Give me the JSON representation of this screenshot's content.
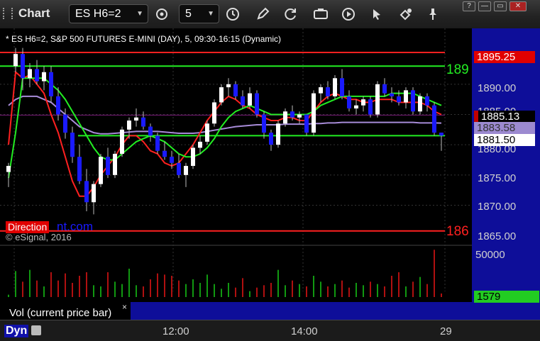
{
  "window": {
    "title": "Chart",
    "minimize": "—",
    "restore": "▭",
    "close": "✕",
    "help": "?"
  },
  "toolbar": {
    "symbol": "ES H6=2",
    "interval": "5"
  },
  "chart": {
    "header": "* ES H6=2, S&P 500 FUTURES E-MINI (DAY), 5, 09:30-16:15 (Dynamic)",
    "copyright": "© eSignal, 2016",
    "watermark_left": "Direction",
    "watermark_right": "nt.com",
    "right_green_label": "189",
    "right_red_label": "186",
    "price_flags": {
      "top_red": "1895.25",
      "red_mid": "1885.13",
      "purple": "1883.58",
      "white": "1881.50"
    },
    "price_ticks": [
      "1890.00",
      "1885.00",
      "1880.00",
      "1875.00",
      "1870.00",
      "1865.00"
    ],
    "volume_ticks": [
      "50000"
    ],
    "volume_flag": "1579",
    "volume_label": "Vol (current price bar)",
    "volume_close": "×",
    "time_ticks": [
      "12:00",
      "14:00",
      "29"
    ],
    "bottom_label": "Dyn",
    "colors": {
      "up_candle": "#ffffff",
      "down_candle": "#1a1aff",
      "red_line": "#ff2020",
      "green_line": "#22ee22",
      "purple_line": "#a78bd8",
      "volume_red": "#b01010",
      "volume_green": "#119911"
    }
  },
  "chart_data": {
    "type": "candlestick",
    "horizontal_lines": [
      {
        "price": 1895.25,
        "color": "#ff2020"
      },
      {
        "price": 1893.0,
        "color": "#22ee22"
      },
      {
        "price": 1881.5,
        "color": "#22ee22"
      },
      {
        "price": 1865.75,
        "color": "#ff2020"
      }
    ],
    "ohlc": [
      [
        1875.5,
        1877.0,
        1873.0,
        1876.5
      ],
      [
        1893.0,
        1896.0,
        1892.0,
        1895.0
      ],
      [
        1895.0,
        1896.0,
        1889.0,
        1891.0
      ],
      [
        1891.0,
        1893.5,
        1889.5,
        1892.5
      ],
      [
        1892.5,
        1894.0,
        1890.0,
        1890.5
      ],
      [
        1890.5,
        1893.0,
        1889.0,
        1892.0
      ],
      [
        1892.0,
        1893.0,
        1887.0,
        1888.0
      ],
      [
        1888.0,
        1889.5,
        1884.0,
        1885.0
      ],
      [
        1885.0,
        1886.0,
        1881.0,
        1882.0
      ],
      [
        1882.0,
        1883.0,
        1877.0,
        1878.0
      ],
      [
        1878.0,
        1880.0,
        1873.5,
        1874.0
      ],
      [
        1874.0,
        1876.0,
        1869.0,
        1870.5
      ],
      [
        1870.5,
        1874.0,
        1868.5,
        1873.5
      ],
      [
        1873.5,
        1878.5,
        1873.0,
        1878.0
      ],
      [
        1878.0,
        1879.5,
        1874.5,
        1875.0
      ],
      [
        1875.0,
        1879.0,
        1874.5,
        1878.5
      ],
      [
        1878.5,
        1883.0,
        1878.0,
        1882.5
      ],
      [
        1882.5,
        1884.5,
        1881.0,
        1884.0
      ],
      [
        1884.0,
        1886.0,
        1883.0,
        1884.5
      ],
      [
        1884.5,
        1885.5,
        1882.5,
        1883.0
      ],
      [
        1883.0,
        1883.5,
        1880.5,
        1881.5
      ],
      [
        1881.5,
        1882.0,
        1878.5,
        1879.0
      ],
      [
        1879.0,
        1880.5,
        1877.5,
        1878.0
      ],
      [
        1878.0,
        1879.0,
        1876.0,
        1877.0
      ],
      [
        1877.0,
        1878.5,
        1874.5,
        1875.0
      ],
      [
        1875.0,
        1877.0,
        1873.0,
        1876.5
      ],
      [
        1876.5,
        1880.0,
        1876.0,
        1879.5
      ],
      [
        1879.5,
        1881.5,
        1878.5,
        1880.5
      ],
      [
        1880.5,
        1884.0,
        1880.0,
        1883.5
      ],
      [
        1883.5,
        1887.5,
        1883.0,
        1887.0
      ],
      [
        1887.0,
        1890.0,
        1886.5,
        1889.5
      ],
      [
        1889.5,
        1891.0,
        1888.0,
        1890.0
      ],
      [
        1890.0,
        1890.5,
        1887.5,
        1888.0
      ],
      [
        1888.0,
        1889.0,
        1886.0,
        1886.5
      ],
      [
        1886.5,
        1889.5,
        1886.0,
        1888.5
      ],
      [
        1888.5,
        1889.0,
        1884.5,
        1885.0
      ],
      [
        1885.0,
        1885.5,
        1881.0,
        1882.0
      ],
      [
        1882.0,
        1882.5,
        1879.0,
        1880.0
      ],
      [
        1880.0,
        1884.0,
        1879.5,
        1883.5
      ],
      [
        1883.5,
        1886.0,
        1883.0,
        1885.5
      ],
      [
        1885.5,
        1886.5,
        1884.0,
        1884.5
      ],
      [
        1884.5,
        1885.5,
        1883.5,
        1885.0
      ],
      [
        1885.0,
        1885.0,
        1881.5,
        1882.0
      ],
      [
        1882.0,
        1889.0,
        1881.5,
        1888.5
      ],
      [
        1888.5,
        1890.0,
        1887.0,
        1889.5
      ],
      [
        1889.5,
        1890.5,
        1887.5,
        1888.0
      ],
      [
        1888.0,
        1891.5,
        1887.5,
        1891.0
      ],
      [
        1891.0,
        1892.5,
        1887.5,
        1888.0
      ],
      [
        1888.0,
        1889.0,
        1885.5,
        1886.0
      ],
      [
        1886.0,
        1887.5,
        1885.0,
        1886.5
      ],
      [
        1886.5,
        1888.0,
        1885.5,
        1887.5
      ],
      [
        1887.5,
        1888.0,
        1884.5,
        1885.0
      ],
      [
        1885.0,
        1890.5,
        1884.5,
        1890.0
      ],
      [
        1890.0,
        1891.0,
        1888.0,
        1888.5
      ],
      [
        1888.5,
        1889.5,
        1887.0,
        1888.0
      ],
      [
        1888.0,
        1889.0,
        1886.5,
        1887.0
      ],
      [
        1887.0,
        1889.5,
        1886.0,
        1889.0
      ],
      [
        1889.0,
        1889.5,
        1885.0,
        1885.5
      ],
      [
        1885.5,
        1888.5,
        1885.0,
        1888.0
      ],
      [
        1888.0,
        1888.5,
        1885.5,
        1886.5
      ],
      [
        1886.5,
        1887.0,
        1881.5,
        1882.0
      ],
      [
        1882.0,
        1882.0,
        1879.0,
        1881.5
      ]
    ],
    "volume": [
      2,
      22,
      13,
      23,
      14,
      9,
      21,
      14,
      20,
      12,
      18,
      21,
      10,
      9,
      21,
      13,
      11,
      24,
      10,
      9,
      15,
      20,
      19,
      18,
      14,
      11,
      15,
      12,
      19,
      11,
      7,
      12,
      8,
      16,
      5,
      8,
      10,
      12,
      23,
      10,
      14,
      11,
      9,
      18,
      13,
      9,
      11,
      14,
      8,
      12,
      10,
      13,
      11,
      9,
      18,
      21,
      9,
      13,
      17,
      11,
      40,
      3
    ],
    "red_ma": [
      1880,
      1892,
      1891,
      1891.5,
      1890,
      1888.5,
      1885,
      1882,
      1878,
      1874,
      1871.5,
      1871.5,
      1873,
      1875,
      1876.5,
      1878,
      1880,
      1881.5,
      1881.5,
      1880.5,
      1879,
      1878.5,
      1877,
      1876.5,
      1877,
      1878.5,
      1880,
      1882,
      1884,
      1885.5,
      1887,
      1888,
      1887.5,
      1886.5,
      1886,
      1885,
      1884.5,
      1884,
      1884,
      1884.5,
      1884.5,
      1884,
      1884,
      1885.5,
      1887,
      1888,
      1888.5,
      1888,
      1887.5,
      1887.5,
      1887,
      1887,
      1887.5,
      1887.5,
      1887.5,
      1887,
      1887,
      1887,
      1887,
      1886.5,
      1885.5,
      1885.0
    ],
    "green_ma": [
      1874.5,
      1882,
      1891,
      1891,
      1891,
      1891,
      1890,
      1889,
      1887.5,
      1885.5,
      1883.5,
      1881.5,
      1879.5,
      1878,
      1877.5,
      1877.5,
      1878.5,
      1879.5,
      1880.5,
      1881,
      1881.5,
      1881,
      1880.5,
      1879.5,
      1878.5,
      1878,
      1878,
      1878.5,
      1879.5,
      1881,
      1883,
      1884.5,
      1885.5,
      1886,
      1886.5,
      1886,
      1885.5,
      1885,
      1885,
      1885,
      1885,
      1885,
      1885,
      1885.5,
      1886.5,
      1887,
      1887.5,
      1888,
      1888,
      1888,
      1888,
      1888,
      1888,
      1888,
      1888.5,
      1888.5,
      1888.5,
      1888.5,
      1888,
      1887.5,
      1887,
      1886.5
    ],
    "purple_ma": [
      1886.5,
      1887.5,
      1888,
      1888,
      1888,
      1887.5,
      1887,
      1886,
      1885,
      1884,
      1883,
      1882.5,
      1882,
      1881.8,
      1881.8,
      1881.9,
      1882,
      1882.1,
      1882.2,
      1882.2,
      1882.2,
      1882.2,
      1882.1,
      1882,
      1881.9,
      1881.9,
      1881.9,
      1882,
      1882.2,
      1882.4,
      1882.6,
      1882.8,
      1883,
      1883.1,
      1883.2,
      1883.3,
      1883.3,
      1883.3,
      1883.3,
      1883.4,
      1883.4,
      1883.4,
      1883.4,
      1883.5,
      1883.5,
      1883.6,
      1883.6,
      1883.7,
      1883.7,
      1883.7,
      1883.7,
      1883.7,
      1883.7,
      1883.7,
      1883.7,
      1883.7,
      1883.7,
      1883.7,
      1883.6,
      1883.6,
      1883.6,
      1883.58
    ],
    "ylim": [
      1863.5,
      1899.0
    ]
  }
}
